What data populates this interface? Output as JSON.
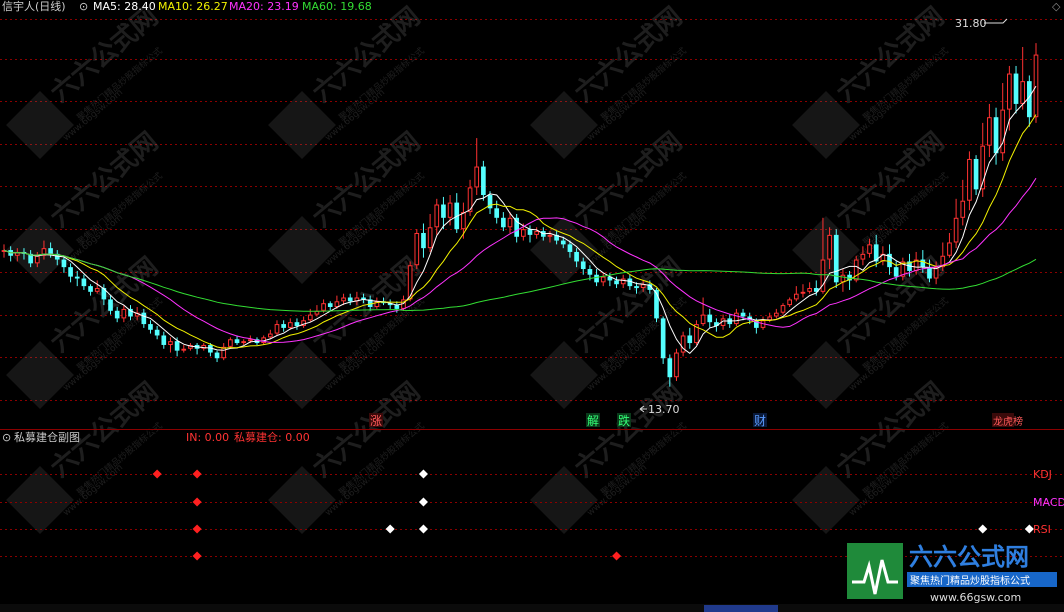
{
  "main_panel": {
    "title": "信宇人(日线)",
    "ma_labels": [
      {
        "text": "MA5: 28.40",
        "color": "#ffffff"
      },
      {
        "text": "MA10: 26.27",
        "color": "#f2f200"
      },
      {
        "text": "MA20: 23.19",
        "color": "#ff33ff"
      },
      {
        "text": "MA60: 19.68",
        "color": "#33dd33"
      }
    ],
    "max_label": "31.80",
    "min_label": "13.70",
    "event_markers": [
      {
        "text": "涨",
        "kind": "up"
      },
      {
        "text": "解",
        "kind": "down"
      },
      {
        "text": "跌",
        "kind": "down"
      },
      {
        "text": "财",
        "kind": "info"
      },
      {
        "text": "龙虎榜",
        "kind": "up"
      }
    ]
  },
  "sub_panel": {
    "title": "私募建仓副图",
    "values": [
      {
        "text": "IN: 0.00",
        "color": "#ff3333"
      },
      {
        "text": "私募建仓: 0.00",
        "color": "#ff3333"
      }
    ],
    "row_labels": [
      {
        "text": "KDJ",
        "color": "#ff3333"
      },
      {
        "text": "MACD",
        "color": "#ff33ff"
      },
      {
        "text": "RSI",
        "color": "#ff3333"
      },
      {
        "text": "",
        "color": "#33dd33"
      }
    ]
  },
  "watermark": {
    "brand": "六六公式网",
    "slogan": "聚焦热门精品炒股指标公式",
    "url": "www.66gsw.com"
  },
  "colors": {
    "up": "#ff3232",
    "down": "#54ffff",
    "grid": "#8b0000",
    "ma5": "#ffffff",
    "ma10": "#f2f200",
    "ma20": "#ff33ff",
    "ma60": "#33dd33"
  },
  "chart_data": [
    {
      "type": "candlestick",
      "title": "信宇人(日线)",
      "ylim": [
        13.0,
        33.0
      ],
      "candles": [
        [
          20.8,
          20.9,
          21.2,
          20.5
        ],
        [
          20.9,
          20.6,
          21.1,
          20.3
        ],
        [
          20.6,
          20.8,
          21.0,
          20.3
        ],
        [
          20.8,
          20.7,
          21.0,
          20.4
        ],
        [
          20.7,
          20.2,
          20.9,
          20.0
        ],
        [
          20.2,
          20.6,
          20.8,
          20.0
        ],
        [
          20.6,
          21.0,
          21.4,
          20.4
        ],
        [
          21.0,
          20.7,
          21.3,
          20.5
        ],
        [
          20.7,
          20.4,
          20.9,
          20.1
        ],
        [
          20.4,
          20.0,
          20.6,
          19.7
        ],
        [
          20.0,
          19.5,
          20.2,
          19.2
        ],
        [
          19.5,
          19.4,
          19.8,
          19.0
        ],
        [
          19.4,
          19.0,
          19.6,
          18.8
        ],
        [
          19.0,
          18.7,
          19.1,
          18.5
        ],
        [
          18.7,
          18.9,
          19.3,
          18.6
        ],
        [
          18.9,
          18.3,
          19.1,
          18.0
        ],
        [
          18.3,
          17.7,
          18.5,
          17.5
        ],
        [
          17.7,
          17.3,
          17.9,
          17.1
        ],
        [
          17.3,
          17.8,
          18.0,
          17.1
        ],
        [
          17.8,
          17.4,
          18.0,
          17.2
        ],
        [
          17.4,
          17.6,
          17.9,
          17.2
        ],
        [
          17.6,
          17.0,
          17.8,
          16.8
        ],
        [
          17.0,
          16.7,
          17.2,
          16.5
        ],
        [
          16.7,
          16.4,
          16.9,
          16.2
        ],
        [
          16.4,
          15.9,
          16.6,
          15.7
        ],
        [
          15.9,
          16.1,
          16.3,
          15.5
        ],
        [
          16.1,
          15.6,
          16.3,
          15.3
        ],
        [
          15.6,
          15.7,
          15.9,
          15.5
        ],
        [
          15.7,
          15.9,
          16.0,
          15.6
        ],
        [
          15.9,
          15.7,
          16.0,
          15.4
        ],
        [
          15.7,
          15.9,
          16.0,
          15.6
        ],
        [
          15.9,
          15.5,
          16.0,
          15.3
        ],
        [
          15.5,
          15.2,
          15.6,
          15.0
        ],
        [
          15.2,
          15.8,
          16.0,
          15.1
        ],
        [
          15.8,
          16.2,
          16.3,
          15.7
        ],
        [
          16.2,
          16.0,
          16.4,
          15.9
        ],
        [
          16.0,
          16.1,
          16.2,
          15.9
        ],
        [
          16.1,
          16.2,
          16.4,
          16.0
        ],
        [
          16.2,
          16.0,
          16.3,
          15.9
        ],
        [
          16.0,
          16.3,
          16.4,
          15.9
        ],
        [
          16.3,
          16.5,
          16.7,
          16.2
        ],
        [
          16.5,
          17.0,
          17.2,
          16.4
        ],
        [
          17.0,
          16.8,
          17.2,
          16.6
        ],
        [
          16.8,
          17.1,
          17.3,
          16.7
        ],
        [
          17.1,
          16.9,
          17.3,
          16.7
        ],
        [
          16.9,
          17.2,
          17.4,
          16.8
        ],
        [
          17.2,
          17.5,
          17.8,
          17.1
        ],
        [
          17.5,
          17.7,
          18.0,
          17.4
        ],
        [
          17.7,
          18.1,
          18.3,
          17.6
        ],
        [
          18.1,
          17.9,
          18.2,
          17.7
        ],
        [
          17.9,
          18.2,
          18.5,
          17.8
        ],
        [
          18.2,
          18.4,
          18.6,
          18.0
        ],
        [
          18.4,
          18.2,
          18.6,
          18.0
        ],
        [
          18.2,
          18.4,
          18.7,
          18.0
        ],
        [
          18.4,
          18.3,
          18.6,
          18.1
        ],
        [
          18.3,
          17.9,
          18.5,
          17.7
        ],
        [
          17.9,
          18.2,
          18.4,
          17.8
        ],
        [
          18.2,
          18.1,
          18.4,
          18.0
        ],
        [
          18.1,
          18.0,
          18.3,
          17.8
        ],
        [
          18.0,
          17.8,
          18.2,
          17.6
        ],
        [
          17.8,
          18.3,
          18.5,
          17.7
        ],
        [
          18.3,
          20.1,
          20.3,
          18.2
        ],
        [
          20.1,
          21.8,
          22.0,
          19.9
        ],
        [
          21.8,
          21.0,
          22.3,
          20.5
        ],
        [
          21.0,
          22.1,
          22.8,
          20.8
        ],
        [
          22.1,
          23.3,
          23.6,
          21.7
        ],
        [
          23.3,
          22.6,
          23.7,
          22.0
        ],
        [
          22.6,
          23.4,
          23.8,
          22.2
        ],
        [
          23.4,
          22.0,
          23.9,
          21.8
        ],
        [
          22.0,
          22.9,
          23.4,
          21.5
        ],
        [
          22.9,
          24.2,
          24.6,
          22.7
        ],
        [
          24.2,
          25.3,
          26.8,
          23.8
        ],
        [
          25.3,
          23.8,
          25.6,
          23.5
        ],
        [
          23.8,
          23.1,
          24.0,
          22.8
        ],
        [
          23.1,
          22.6,
          23.5,
          22.3
        ],
        [
          22.6,
          22.1,
          22.9,
          21.9
        ],
        [
          22.1,
          22.6,
          22.9,
          21.8
        ],
        [
          22.6,
          21.6,
          22.8,
          21.3
        ],
        [
          21.6,
          22.0,
          22.3,
          21.4
        ],
        [
          22.0,
          21.7,
          22.2,
          21.3
        ],
        [
          21.7,
          21.9,
          22.1,
          21.5
        ],
        [
          21.9,
          21.6,
          22.1,
          21.4
        ],
        [
          21.6,
          21.7,
          21.9,
          21.3
        ],
        [
          21.7,
          21.4,
          21.9,
          21.2
        ],
        [
          21.4,
          21.2,
          21.6,
          21.0
        ],
        [
          21.2,
          20.8,
          21.4,
          20.5
        ],
        [
          20.8,
          20.3,
          21.0,
          20.0
        ],
        [
          20.3,
          19.9,
          20.5,
          19.6
        ],
        [
          19.9,
          19.6,
          20.1,
          19.3
        ],
        [
          19.6,
          19.2,
          19.9,
          19.0
        ],
        [
          19.2,
          19.5,
          19.7,
          19.0
        ],
        [
          19.5,
          19.3,
          19.7,
          19.0
        ],
        [
          19.3,
          19.1,
          19.5,
          18.9
        ],
        [
          19.1,
          19.4,
          19.6,
          18.9
        ],
        [
          19.4,
          19.0,
          19.6,
          18.8
        ],
        [
          19.0,
          18.9,
          19.2,
          18.6
        ],
        [
          18.9,
          19.1,
          19.3,
          18.7
        ],
        [
          19.1,
          18.8,
          19.3,
          18.6
        ],
        [
          18.8,
          17.3,
          18.9,
          17.1
        ],
        [
          17.3,
          15.2,
          17.4,
          14.9
        ],
        [
          15.2,
          14.2,
          15.4,
          13.7
        ],
        [
          14.2,
          15.5,
          15.7,
          14.0
        ],
        [
          15.5,
          16.4,
          16.6,
          15.3
        ],
        [
          16.4,
          16.0,
          16.8,
          15.7
        ],
        [
          16.0,
          17.0,
          17.2,
          15.9
        ],
        [
          17.0,
          17.5,
          18.4,
          16.9
        ],
        [
          17.5,
          17.1,
          17.8,
          16.8
        ],
        [
          17.1,
          16.9,
          17.3,
          16.6
        ],
        [
          16.9,
          17.3,
          17.5,
          16.7
        ],
        [
          17.3,
          17.0,
          17.5,
          16.8
        ],
        [
          17.0,
          17.6,
          17.8,
          16.9
        ],
        [
          17.6,
          17.4,
          17.8,
          17.2
        ],
        [
          17.4,
          17.2,
          17.6,
          17.0
        ],
        [
          17.2,
          16.8,
          17.3,
          16.5
        ],
        [
          16.8,
          17.2,
          17.4,
          16.7
        ],
        [
          17.2,
          17.4,
          17.6,
          17.1
        ],
        [
          17.4,
          17.6,
          17.8,
          17.3
        ],
        [
          17.6,
          18.0,
          18.1,
          17.5
        ],
        [
          18.0,
          18.3,
          18.4,
          17.9
        ],
        [
          18.3,
          18.6,
          19.0,
          18.2
        ],
        [
          18.6,
          18.7,
          19.1,
          18.4
        ],
        [
          18.7,
          18.9,
          19.2,
          18.6
        ],
        [
          18.9,
          18.7,
          19.3,
          18.5
        ],
        [
          18.7,
          20.4,
          22.6,
          18.6
        ],
        [
          20.4,
          21.7,
          22.1,
          19.9
        ],
        [
          21.7,
          19.2,
          22.0,
          18.9
        ],
        [
          19.2,
          19.6,
          19.9,
          18.7
        ],
        [
          19.6,
          19.3,
          19.8,
          18.8
        ],
        [
          19.3,
          20.4,
          20.6,
          19.2
        ],
        [
          20.4,
          20.7,
          21.1,
          20.1
        ],
        [
          20.7,
          21.2,
          21.5,
          20.5
        ],
        [
          21.2,
          20.3,
          21.7,
          20.0
        ],
        [
          20.3,
          20.7,
          21.1,
          20.1
        ],
        [
          20.7,
          20.0,
          21.2,
          19.6
        ],
        [
          20.0,
          19.5,
          20.3,
          19.3
        ],
        [
          19.5,
          20.3,
          20.5,
          19.3
        ],
        [
          20.3,
          19.8,
          20.7,
          19.5
        ],
        [
          19.8,
          20.4,
          20.8,
          19.6
        ],
        [
          20.4,
          20.0,
          20.9,
          19.7
        ],
        [
          20.0,
          19.4,
          20.4,
          19.2
        ],
        [
          19.4,
          20.0,
          20.3,
          19.1
        ],
        [
          20.0,
          20.6,
          21.3,
          19.8
        ],
        [
          20.6,
          21.3,
          21.8,
          20.5
        ],
        [
          21.3,
          22.6,
          23.6,
          21.0
        ],
        [
          22.6,
          23.5,
          24.6,
          22.2
        ],
        [
          23.5,
          25.7,
          26.1,
          23.0
        ],
        [
          25.7,
          24.1,
          25.9,
          23.8
        ],
        [
          24.1,
          26.4,
          27.6,
          23.7
        ],
        [
          26.4,
          27.9,
          28.6,
          25.8
        ],
        [
          27.9,
          26.0,
          28.4,
          25.4
        ],
        [
          26.0,
          28.3,
          29.7,
          25.6
        ],
        [
          28.3,
          30.2,
          30.6,
          27.2
        ],
        [
          30.2,
          28.6,
          30.6,
          28.1
        ],
        [
          28.6,
          29.8,
          31.6,
          28.3
        ],
        [
          29.8,
          27.9,
          30.1,
          27.4
        ],
        [
          27.9,
          31.2,
          31.8,
          27.6
        ]
      ]
    },
    {
      "type": "line",
      "title": "",
      "series": [
        {
          "name": "MA5",
          "values": []
        },
        {
          "name": "MA10",
          "values": []
        },
        {
          "name": "MA20",
          "values": []
        },
        {
          "name": "MA60",
          "values": []
        }
      ]
    },
    {
      "type": "scatter",
      "title": "私募建仓副图",
      "series": [
        {
          "name": "KDJ",
          "points": [
            [
              23,
              "red"
            ],
            [
              29,
              "red"
            ],
            [
              63,
              "white"
            ]
          ]
        },
        {
          "name": "MACD",
          "points": [
            [
              29,
              "red"
            ],
            [
              63,
              "white"
            ]
          ]
        },
        {
          "name": "RSI",
          "points": [
            [
              29,
              "red"
            ],
            [
              58,
              "white"
            ],
            [
              63,
              "white"
            ],
            [
              147,
              "white"
            ],
            [
              154,
              "white"
            ]
          ]
        },
        {
          "name": "",
          "points": [
            [
              29,
              "red"
            ],
            [
              92,
              "red"
            ]
          ]
        }
      ]
    }
  ]
}
